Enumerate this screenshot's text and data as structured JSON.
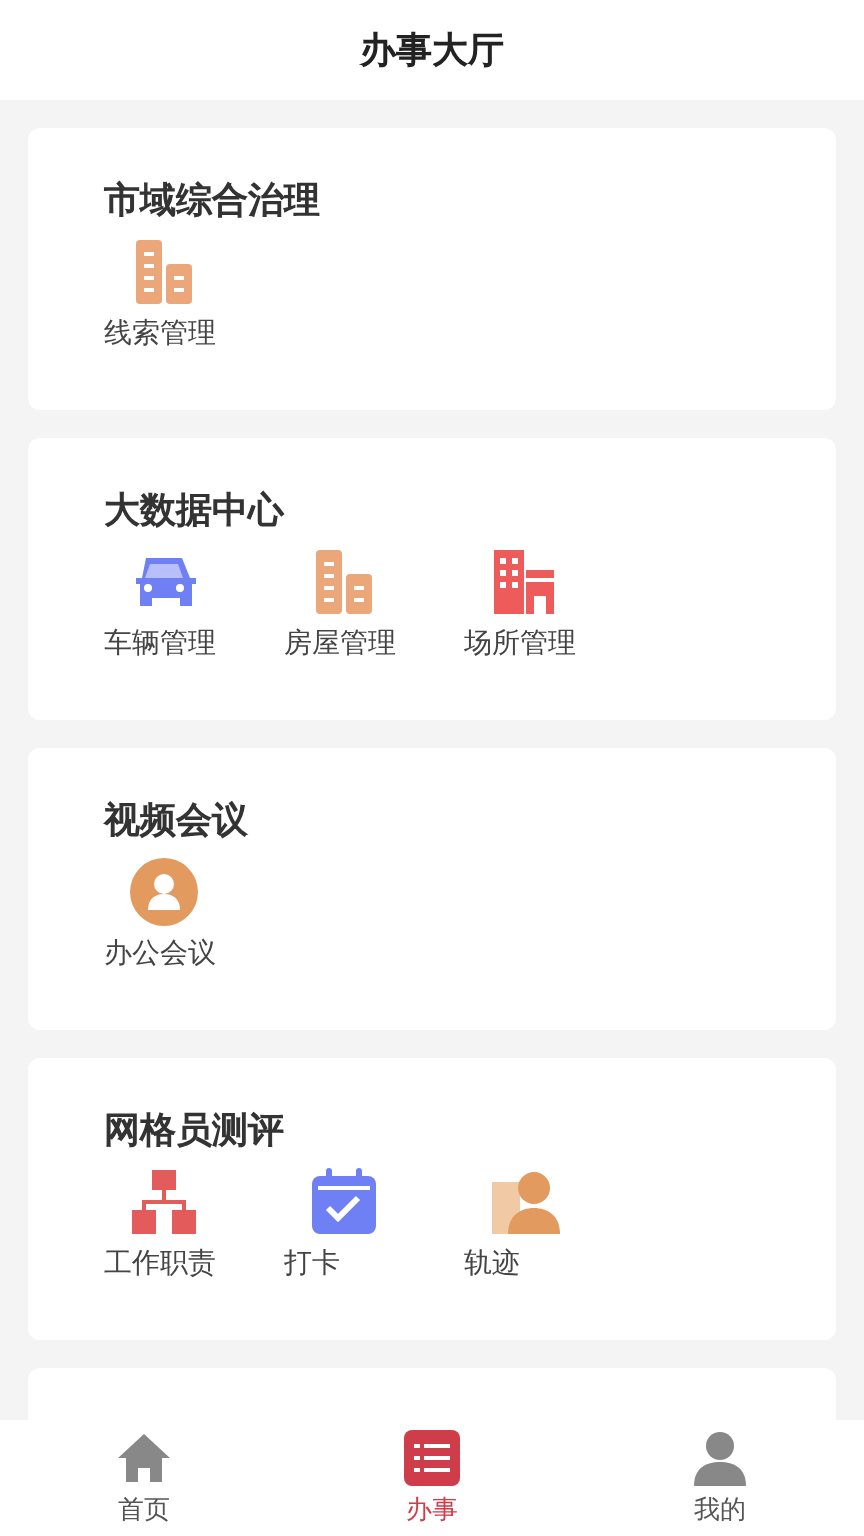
{
  "header": {
    "title": "办事大厅"
  },
  "sections": [
    {
      "kind": "group",
      "title": "市域综合治理",
      "items": [
        {
          "label": "线索管理",
          "kind": "buildings"
        }
      ]
    },
    {
      "kind": "group",
      "title": "大数据中心",
      "items": [
        {
          "label": "车辆管理",
          "kind": "car"
        },
        {
          "label": "房屋管理",
          "kind": "buildings"
        },
        {
          "label": "场所管理",
          "kind": "shop"
        }
      ]
    },
    {
      "kind": "group",
      "title": "视频会议",
      "items": [
        {
          "label": "办公会议",
          "kind": "avatar"
        }
      ]
    },
    {
      "kind": "group",
      "title": "网格员测评",
      "items": [
        {
          "label": "工作职责",
          "kind": "org"
        },
        {
          "label": "打卡",
          "kind": "calendar"
        },
        {
          "label": "轨迹",
          "kind": "agent"
        }
      ]
    },
    {
      "kind": "partial"
    }
  ],
  "tabs": [
    {
      "label": "首页",
      "kind": "home",
      "selected": false
    },
    {
      "label": "办事",
      "kind": "list",
      "selected": true
    },
    {
      "label": "我的",
      "kind": "person",
      "selected": false
    }
  ]
}
